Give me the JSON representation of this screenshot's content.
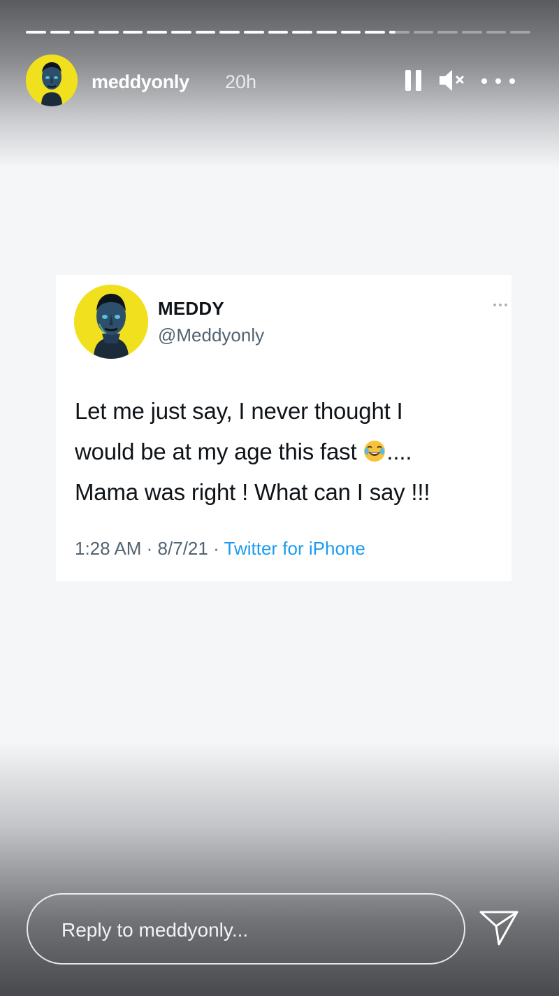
{
  "story": {
    "progress": {
      "segments": 21,
      "completed": 15,
      "current_fraction": 0.3
    },
    "header": {
      "username": "meddyonly",
      "time_ago": "20h",
      "avatar_color": "#f1e01d",
      "icons": [
        "pause-icon",
        "mute-icon",
        "more-icon"
      ]
    },
    "tweet": {
      "display_name": "MEDDY",
      "handle": "@Meddyonly",
      "text_lines": [
        "Let me just say, I never thought I",
        "would be at my age this fast",
        "....",
        "Mama was right ! What can I say !!!"
      ],
      "emoji": "face-with-tears-of-joy",
      "time": "1:28 AM",
      "separator": "·",
      "date": "8/7/21",
      "source": "Twitter for iPhone",
      "source_color": "#1d9bf0"
    },
    "reply": {
      "placeholder": "Reply to meddyonly...",
      "send_icon": "send-icon"
    }
  }
}
